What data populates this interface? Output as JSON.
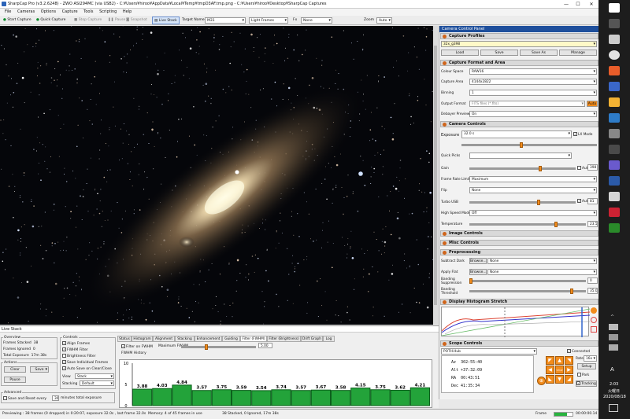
{
  "window": {
    "title": "SharpCap Pro (v3.2.6248) - ZWO ASI294MC (via USB2) - C:¥Users¥hiroo¥AppData¥Local¥Temp¥tmpD3AF.tmp.png - C:¥Users¥hiroo¥Desktop¥SharpCap Captures",
    "minimize": "—",
    "maximize": "☐",
    "close": "✕"
  },
  "menu": [
    "File",
    "Cameras",
    "Options",
    "Capture",
    "Tools",
    "Scripting",
    "Help"
  ],
  "toolbar": {
    "start_capture": "Start Capture",
    "quick_capture": "Quick Capture",
    "stop_capture": "Stop Capture",
    "pause": "Pause",
    "snapshot": "Snapshot",
    "live_stack": "Live Stack",
    "target_name_label": "Target Name",
    "target_name": "M31",
    "frame_type": "Light Frames",
    "fx_label": "Fx",
    "fx_value": "None",
    "zoom_label": "Zoom",
    "zoom_value": "Auto"
  },
  "ccp": {
    "title": "Camera Control Panel",
    "capture_profiles": {
      "header": "Capture Profiles",
      "profile": "32x_g398",
      "buttons": [
        "Load",
        "Save",
        "Save As",
        "Manage"
      ]
    },
    "format": {
      "header": "Capture Format and Area",
      "colour_space_label": "Colour Space",
      "colour_space": "RAW16",
      "capture_area_label": "Capture Area",
      "capture_area": "4144x2822",
      "binning_label": "Binning",
      "binning": "1",
      "output_format_label": "Output Format",
      "output_format": "FITS files (*.fits)",
      "output_auto": "Auto",
      "debayer_label": "Debayer Preview",
      "debayer": "On"
    },
    "controls": {
      "header": "Camera Controls",
      "exposure_label": "Exposure",
      "exposure": "32.0 s",
      "lx_mode": "LX Mode",
      "quick_picks_label": "Quick Picks",
      "gain_label": "Gain",
      "gain_auto": "Auto",
      "gain": "398",
      "frame_rate_label": "Frame Rate Limit",
      "frame_rate": "Maximum",
      "flip_label": "Flip",
      "flip": "None",
      "turbo_label": "Turbo USB",
      "turbo_auto": "Auto",
      "turbo": "81",
      "hsm_label": "High Speed Mode",
      "hsm": "Off",
      "temp_label": "Temperature",
      "temp": "23.5"
    },
    "image_controls": "Image Controls",
    "misc_controls": "Misc Controls",
    "preprocessing": {
      "header": "Preprocessing",
      "subtract_dark_label": "Subtract Dark",
      "browse": "Browse...",
      "subtract_dark": "None",
      "apply_flat_label": "Apply Flat",
      "apply_flat": "None",
      "banding_suppression_label": "Banding Suppression",
      "banding_suppression": "0",
      "banding_threshold_label": "Banding Threshold",
      "banding_threshold": "35.0"
    },
    "histogram": {
      "header": "Display Histogram Stretch"
    },
    "scope": {
      "header": "Scope Controls",
      "hub": "POTH.Hub",
      "connected": "Connected",
      "alt_label": "Alt",
      "alt": "+37:32:09",
      "az_label": "Az",
      "az": "302:55:40",
      "ra_label": "RA",
      "ra": "00:43:51",
      "dec_label": "Dec",
      "dec": "41:35:34",
      "rate_label": "Rate",
      "rate": "16x",
      "setup": "Setup",
      "park": "Park",
      "tracking": "Tracking"
    }
  },
  "livestack": {
    "header": "Live Stack",
    "overview": {
      "title": "Overview",
      "frames_stacked_label": "Frames Stacked",
      "frames_stacked": "38",
      "frames_ignored_label": "Frames Ignored",
      "frames_ignored": "0",
      "total_exposure_label": "Total Exposure",
      "total_exposure": "17m 38s"
    },
    "actions": {
      "title": "Actions",
      "clear": "Clear",
      "save": "Save",
      "pause": "Pause"
    },
    "advanced": {
      "title": "Advanced",
      "save_reset_label": "Save and Reset every",
      "save_reset_value": "30",
      "minutes_label": "minutes total exposure"
    },
    "controls": {
      "title": "Controls",
      "align_frames": "Align Frames",
      "fwhm_filter": "FWHM Filter",
      "brightness_filter": "Brightness Filter",
      "save_individual": "Save Individual Frames",
      "auto_save": "Auto Save on Clear/Close",
      "view_label": "View",
      "view": "Stack",
      "stacking_label": "Stacking",
      "stacking": "Default"
    },
    "tabs": [
      "Status",
      "Histogram",
      "Alignment",
      "Stacking",
      "Enhancement",
      "Guiding",
      "Filter (FWHM)",
      "Filter (Brightness)",
      "Drift Graph",
      "Log"
    ],
    "filter_fwhm": {
      "filter_label": "Filter on FWHM",
      "max_fwhm_label": "Maximum FWHM",
      "max_fwhm": "5.00",
      "history_label": "FWHM History"
    }
  },
  "chart_data": {
    "type": "bar",
    "title": "FWHM History",
    "values": [
      3.88,
      4.03,
      4.84,
      3.57,
      3.75,
      3.59,
      3.54,
      3.74,
      3.57,
      3.67,
      3.58,
      4.15,
      3.75,
      3.62,
      4.21
    ],
    "yticks": [
      0,
      5,
      10
    ],
    "ylim": [
      0,
      10
    ],
    "colors": {
      "bar": "#23a33a",
      "bar_dark": "#0c5f1c"
    }
  },
  "status": {
    "previewing": "Previewing : 38 frames (0 dropped) in 0:20:07, exposure 32.0s , last frame 32.0s",
    "memory": "Memory: 4 of 45 frames in use",
    "stacked": "38 Stacked, 0 Ignored, 17m 38s",
    "frames_label": "Frame",
    "time": "00:00:00.14"
  },
  "taskbar": {
    "time": "2:03",
    "day": "火曜日",
    "date": "2020/08/18",
    "lang": "A"
  }
}
